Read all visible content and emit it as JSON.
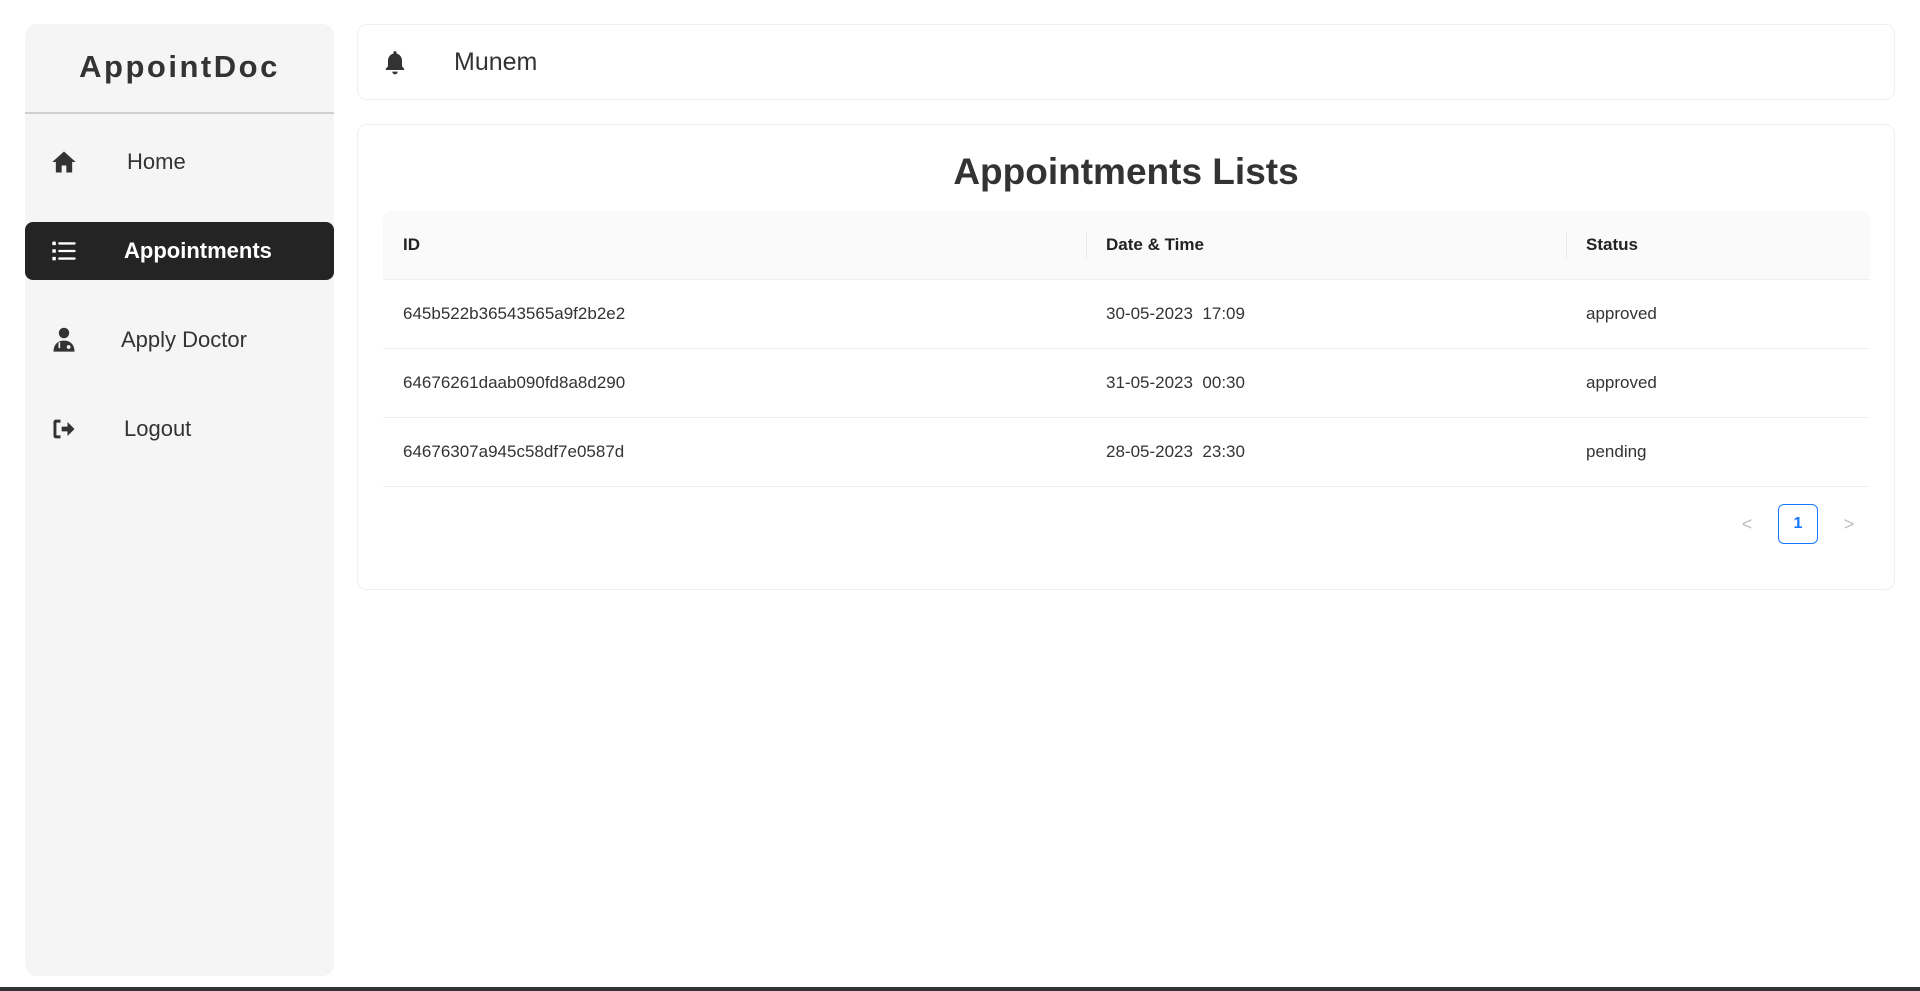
{
  "app": {
    "title": "AppointDoc"
  },
  "sidebar": {
    "items": [
      {
        "label": "Home",
        "icon": "home-icon",
        "active": false
      },
      {
        "label": "Appointments",
        "icon": "list-icon",
        "active": true
      },
      {
        "label": "Apply Doctor",
        "icon": "user-doctor-icon",
        "active": false
      },
      {
        "label": "Logout",
        "icon": "logout-icon",
        "active": false
      }
    ]
  },
  "header": {
    "notification_icon": "bell-icon",
    "username": "Munem"
  },
  "main": {
    "title": "Appointments Lists",
    "columns": [
      "ID",
      "Date & Time",
      "Status"
    ],
    "rows": [
      {
        "id": "645b522b36543565a9f2b2e2",
        "datetime": "30-05-2023  17:09",
        "status": "approved"
      },
      {
        "id": "64676261daab090fd8a8d290",
        "datetime": "31-05-2023  00:30",
        "status": "approved"
      },
      {
        "id": "64676307a945c58df7e0587d",
        "datetime": "28-05-2023  23:30",
        "status": "pending"
      }
    ],
    "pagination": {
      "prev": "<",
      "current": "1",
      "next": ">"
    }
  },
  "colors": {
    "active_nav_bg": "#242424",
    "sidebar_bg": "#f5f5f5",
    "pagination_accent": "#1677ff"
  }
}
